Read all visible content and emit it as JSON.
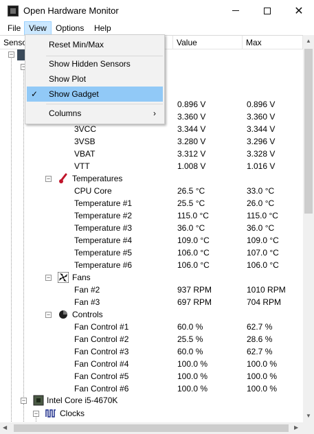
{
  "window": {
    "title": "Open Hardware Monitor"
  },
  "menu": {
    "file": "File",
    "view": "View",
    "options": "Options",
    "help": "Help"
  },
  "columns": {
    "sensor": "Senso",
    "value": "Value",
    "max": "Max"
  },
  "view_menu": {
    "reset": "Reset Min/Max",
    "hidden": "Show Hidden Sensors",
    "plot": "Show Plot",
    "gadget": "Show Gadget",
    "columns": "Columns",
    "check": "✓",
    "arrow": "›"
  },
  "rows": {
    "r0": {
      "name": "",
      "value": "0.896 V",
      "max": "0.896 V"
    },
    "r1": {
      "name": "",
      "value": "3.360 V",
      "max": "3.360 V"
    },
    "vcc3": {
      "name": "3VCC",
      "value": "3.344 V",
      "max": "3.344 V"
    },
    "vsb3": {
      "name": "3VSB",
      "value": "3.280 V",
      "max": "3.296 V"
    },
    "vbat": {
      "name": "VBAT",
      "value": "3.312 V",
      "max": "3.328 V"
    },
    "vtt": {
      "name": "VTT",
      "value": "1.008 V",
      "max": "1.016 V"
    },
    "temps": {
      "name": "Temperatures"
    },
    "cpucore": {
      "name": "CPU Core",
      "value": "26.5 °C",
      "max": "33.0 °C"
    },
    "t1": {
      "name": "Temperature #1",
      "value": "25.5 °C",
      "max": "26.0 °C"
    },
    "t2": {
      "name": "Temperature #2",
      "value": "115.0 °C",
      "max": "115.0 °C"
    },
    "t3": {
      "name": "Temperature #3",
      "value": "36.0 °C",
      "max": "36.0 °C"
    },
    "t4": {
      "name": "Temperature #4",
      "value": "109.0 °C",
      "max": "109.0 °C"
    },
    "t5": {
      "name": "Temperature #5",
      "value": "106.0 °C",
      "max": "107.0 °C"
    },
    "t6": {
      "name": "Temperature #6",
      "value": "106.0 °C",
      "max": "106.0 °C"
    },
    "fans": {
      "name": "Fans"
    },
    "fan2": {
      "name": "Fan #2",
      "value": "937 RPM",
      "max": "1010 RPM"
    },
    "fan3": {
      "name": "Fan #3",
      "value": "697 RPM",
      "max": "704 RPM"
    },
    "controls": {
      "name": "Controls"
    },
    "fc1": {
      "name": "Fan Control #1",
      "value": "60.0 %",
      "max": "62.7 %"
    },
    "fc2": {
      "name": "Fan Control #2",
      "value": "25.5 %",
      "max": "28.6 %"
    },
    "fc3": {
      "name": "Fan Control #3",
      "value": "60.0 %",
      "max": "62.7 %"
    },
    "fc4": {
      "name": "Fan Control #4",
      "value": "100.0 %",
      "max": "100.0 %"
    },
    "fc5": {
      "name": "Fan Control #5",
      "value": "100.0 %",
      "max": "100.0 %"
    },
    "fc6": {
      "name": "Fan Control #6",
      "value": "100.0 %",
      "max": "100.0 %"
    },
    "cpu": {
      "name": "Intel Core i5-4670K"
    },
    "clocks": {
      "name": "Clocks"
    }
  },
  "expander_minus": "−",
  "scroll": {
    "up": "▲",
    "down": "▼",
    "left": "◀",
    "right": "▶"
  }
}
